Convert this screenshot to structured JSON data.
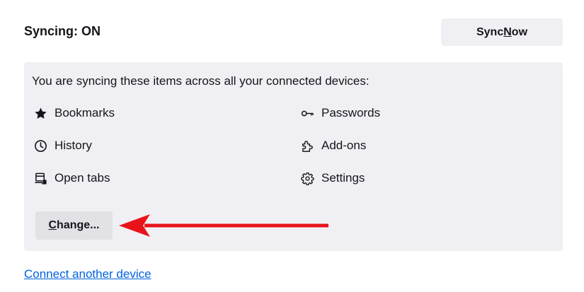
{
  "header": {
    "status": "Syncing: ON"
  },
  "sync_now": {
    "pre": "Sync ",
    "accel": "N",
    "post": "ow"
  },
  "panel": {
    "description": "You are syncing these items across all your connected devices:",
    "items": [
      {
        "label": "Bookmarks",
        "icon": "star-icon"
      },
      {
        "label": "Passwords",
        "icon": "key-icon"
      },
      {
        "label": "History",
        "icon": "clock-icon"
      },
      {
        "label": "Add-ons",
        "icon": "puzzle-icon"
      },
      {
        "label": "Open tabs",
        "icon": "tabs-icon"
      },
      {
        "label": "Settings",
        "icon": "gear-icon"
      }
    ],
    "change": {
      "accel": "C",
      "post": "hange..."
    }
  },
  "annotation": {
    "arrow_color": "#e8141a"
  },
  "links": {
    "connect": "Connect another device"
  },
  "colors": {
    "panel_bg": "#f0f0f4",
    "button_bg": "#f0f0f4",
    "link": "#0061e0",
    "text": "#15141a"
  }
}
